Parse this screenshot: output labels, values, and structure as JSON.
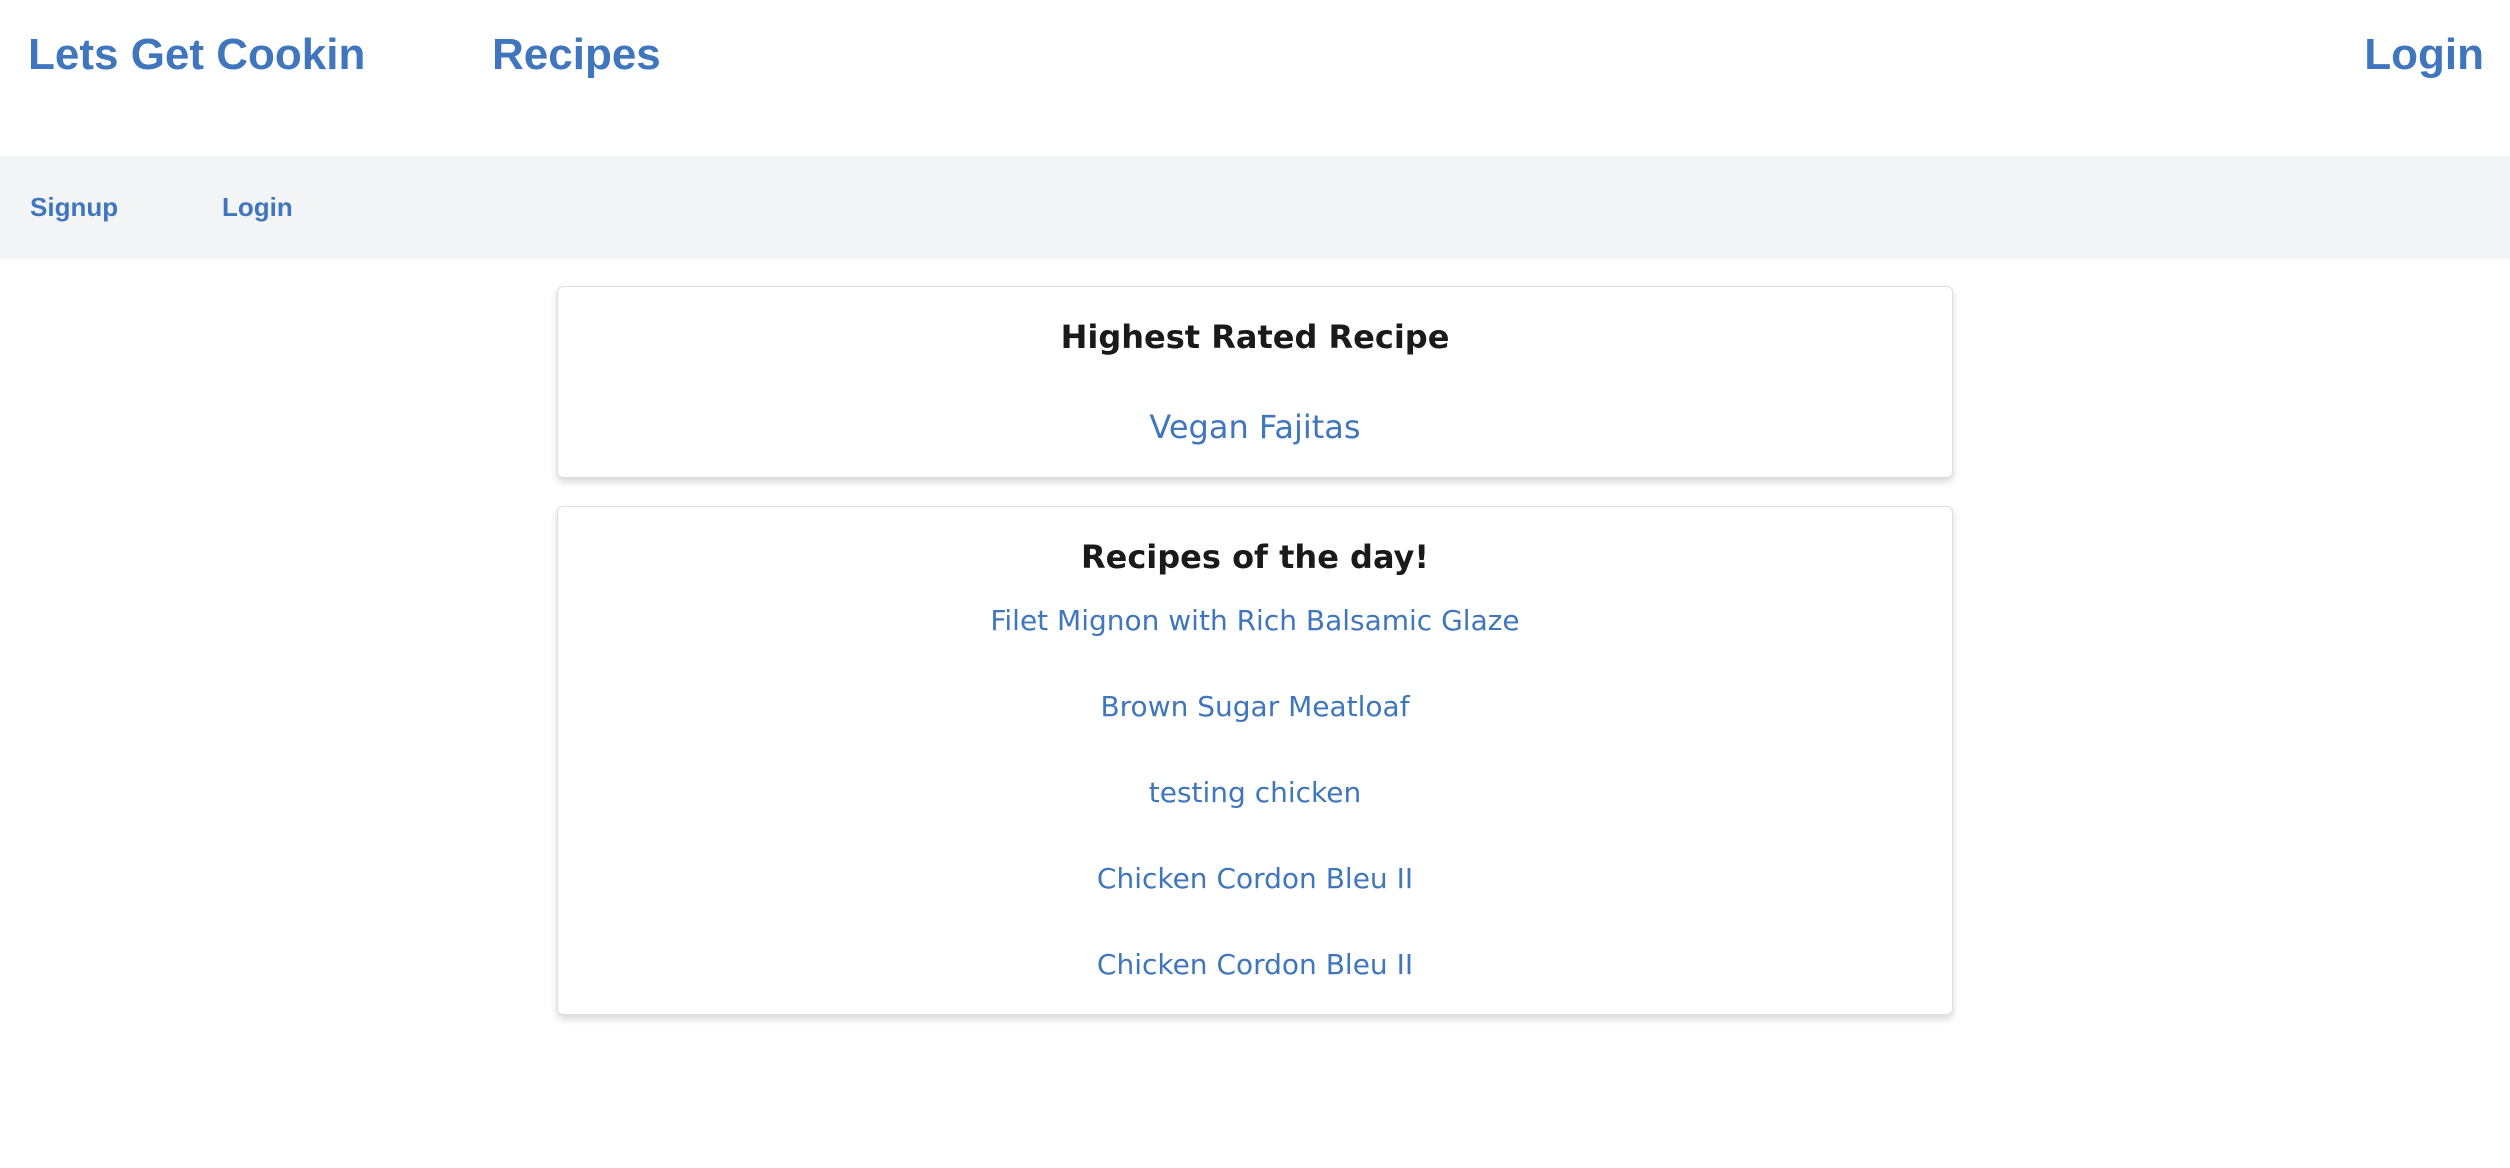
{
  "header": {
    "brand": "Lets Get Cookin",
    "nav_recipes": "Recipes",
    "nav_login": "Login"
  },
  "subnav": {
    "signup": "Signup",
    "login": "Login"
  },
  "highest_rated": {
    "title": "Highest Rated Recipe",
    "recipe": "Vegan Fajitas"
  },
  "recipes_of_day": {
    "title": "Recipes of the day!",
    "items": [
      "Filet Mignon with Rich Balsamic Glaze",
      "Brown Sugar Meatloaf",
      "testing chicken",
      "Chicken Cordon Bleu II",
      "Chicken Cordon Bleu II"
    ]
  },
  "colors": {
    "link": "#3f76bd",
    "subbar_bg": "#f2f4f6",
    "text": "#1a1a1a"
  }
}
